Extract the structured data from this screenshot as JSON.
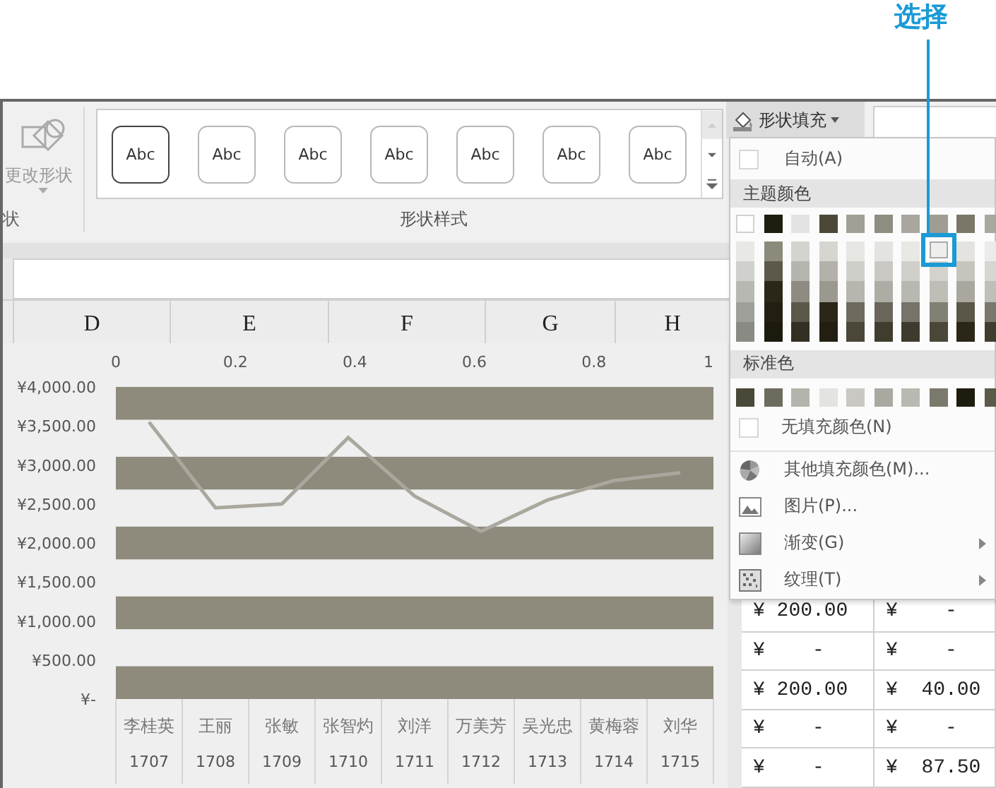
{
  "annotation": {
    "label": "选择"
  },
  "ribbon": {
    "shape_group": {
      "button": "更改形状",
      "caption": "状"
    },
    "shape_styles": {
      "caption": "形状样式",
      "items": [
        {
          "label": "Abc",
          "selected": true
        },
        {
          "label": "Abc",
          "selected": false
        },
        {
          "label": "Abc",
          "selected": false
        },
        {
          "label": "Abc",
          "selected": false
        },
        {
          "label": "Abc",
          "selected": false
        },
        {
          "label": "Abc",
          "selected": false
        },
        {
          "label": "Abc",
          "selected": false
        }
      ]
    },
    "fill_button": {
      "label": "形状填充",
      "expanded": true
    }
  },
  "columns": [
    "D",
    "E",
    "F",
    "G",
    "H"
  ],
  "chart": {
    "chart_data": {
      "type": "line",
      "categories": [
        "李桂英",
        "王丽",
        "张敏",
        "张智灼",
        "刘洋",
        "万美芳",
        "吴光忠",
        "黄梅蓉",
        "刘华"
      ],
      "series": [
        {
          "color": "#aaa89e",
          "values": [
            3550,
            2450,
            2500,
            3350,
            2600,
            2150,
            2550,
            2800,
            2900
          ]
        }
      ],
      "ylim": [
        0,
        4000
      ],
      "yticks": [
        {
          "value": 0,
          "label": "¥-"
        },
        {
          "value": 500,
          "label": "¥500.00"
        },
        {
          "value": 1000,
          "label": "¥1,000.00"
        },
        {
          "value": 1500,
          "label": "¥1,500.00"
        },
        {
          "value": 2000,
          "label": "¥2,000.00"
        },
        {
          "value": 2500,
          "label": "¥2,500.00"
        },
        {
          "value": 3000,
          "label": "¥3,000.00"
        },
        {
          "value": 3500,
          "label": "¥3,500.00"
        },
        {
          "value": 4000,
          "label": "¥4,000.00"
        }
      ]
    },
    "top_axis_labels": [
      "0",
      "0.2",
      "0.4",
      "0.6",
      "0.8",
      "1"
    ],
    "category_codes": [
      "1707",
      "1708",
      "1709",
      "1710",
      "1711",
      "1712",
      "1713",
      "1714",
      "1715"
    ]
  },
  "cells": [
    [
      "¥ 200.00",
      "¥    -"
    ],
    [
      "¥    -",
      "¥    -"
    ],
    [
      "¥ 200.00",
      "¥  40.00"
    ],
    [
      "¥    -",
      "¥    -"
    ],
    [
      "¥    -",
      "¥  87.50"
    ]
  ],
  "fill_menu": {
    "automatic": "自动(A)",
    "theme_header": "主题颜色",
    "theme_top": [
      {
        "color": "#ffffff",
        "selected": false
      },
      {
        "color": "#1f1c10",
        "selected": false
      },
      {
        "color": "#e3e3e1",
        "selected": false
      },
      {
        "color": "#4c4838",
        "selected": false
      },
      {
        "color": "#a19f96",
        "selected": false
      },
      {
        "color": "#8f8c80",
        "selected": false
      },
      {
        "color": "#a8a69e",
        "selected": false
      },
      {
        "color": "#9f9d93",
        "selected": false
      },
      {
        "color": "#7a7768",
        "selected": false
      },
      {
        "color": "#a9a89f",
        "selected": false
      }
    ],
    "theme_shades": [
      [
        {
          "color": "#e8e8e6",
          "selected": false
        },
        {
          "color": "#8c8a7a",
          "selected": false
        },
        {
          "color": "#d3d3cf",
          "selected": false
        },
        {
          "color": "#d6d5d0",
          "selected": false
        },
        {
          "color": "#e6e6e3",
          "selected": false
        },
        {
          "color": "#e3e3e0",
          "selected": false
        },
        {
          "color": "#e8e8e5",
          "selected": false
        },
        {
          "color": "#eeeeec",
          "selected": true
        },
        {
          "color": "#e4e3e0",
          "selected": false
        },
        {
          "color": "#ebebea",
          "selected": false
        }
      ],
      [
        {
          "color": "#d0d0cc",
          "selected": false
        },
        {
          "color": "#5c5948",
          "selected": false
        },
        {
          "color": "#b5b4ad",
          "selected": false
        },
        {
          "color": "#b3b1a9",
          "selected": false
        },
        {
          "color": "#cfcfca",
          "selected": false
        },
        {
          "color": "#c9c8c2",
          "selected": false
        },
        {
          "color": "#d0cfca",
          "selected": false
        },
        {
          "color": "#d3d2cc",
          "selected": false
        },
        {
          "color": "#c5c4bd",
          "selected": false
        },
        {
          "color": "#d5d5d1",
          "selected": false
        }
      ],
      [
        {
          "color": "#b8b8b2",
          "selected": false
        },
        {
          "color": "#2a2718",
          "selected": false
        },
        {
          "color": "#8e8c82",
          "selected": false
        },
        {
          "color": "#9b998f",
          "selected": false
        },
        {
          "color": "#b6b5ae",
          "selected": false
        },
        {
          "color": "#aeada5",
          "selected": false
        },
        {
          "color": "#b8b7b0",
          "selected": false
        },
        {
          "color": "#bebdb6",
          "selected": false
        },
        {
          "color": "#a9a79e",
          "selected": false
        },
        {
          "color": "#bfbeb8",
          "selected": false
        }
      ],
      [
        {
          "color": "#a0a09a",
          "selected": false
        },
        {
          "color": "#221f12",
          "selected": false
        },
        {
          "color": "#5a5849",
          "selected": false
        },
        {
          "color": "#2a2718",
          "selected": false
        },
        {
          "color": "#6e6b5e",
          "selected": false
        },
        {
          "color": "#6a675a",
          "selected": false
        },
        {
          "color": "#75736a",
          "selected": false
        },
        {
          "color": "#808073",
          "selected": false
        },
        {
          "color": "#5a5748",
          "selected": false
        },
        {
          "color": "#7a786d",
          "selected": false
        }
      ],
      [
        {
          "color": "#8a8a84",
          "selected": false
        },
        {
          "color": "#1c190d",
          "selected": false
        },
        {
          "color": "#333023",
          "selected": false
        },
        {
          "color": "#221f12",
          "selected": false
        },
        {
          "color": "#4a4738",
          "selected": false
        },
        {
          "color": "#403d2f",
          "selected": false
        },
        {
          "color": "#3e3b2e",
          "selected": false
        },
        {
          "color": "#4a4738",
          "selected": false
        },
        {
          "color": "#2a2718",
          "selected": false
        },
        {
          "color": "#403d2f",
          "selected": false
        }
      ]
    ],
    "standard_header": "标准色",
    "standard_colors": [
      {
        "color": "#4a4838",
        "selected": false
      },
      {
        "color": "#6d6b5e",
        "selected": false
      },
      {
        "color": "#b4b3ac",
        "selected": false
      },
      {
        "color": "#e3e3e0",
        "selected": false
      },
      {
        "color": "#c9c8c2",
        "selected": false
      },
      {
        "color": "#aaa9a1",
        "selected": false
      },
      {
        "color": "#b9b8b1",
        "selected": false
      },
      {
        "color": "#7b796c",
        "selected": false
      },
      {
        "color": "#1e1b0f",
        "selected": false
      },
      {
        "color": "#5c5a48",
        "selected": false
      }
    ],
    "items": [
      {
        "kind": "no_fill",
        "label": "无填充颜色(N)",
        "submenu": false
      },
      {
        "kind": "more_colors",
        "label": "其他填充颜色(M)...",
        "submenu": false
      },
      {
        "kind": "picture",
        "label": "图片(P)...",
        "submenu": false
      },
      {
        "kind": "gradient",
        "label": "渐变(G)",
        "submenu": true
      },
      {
        "kind": "texture",
        "label": "纹理(T)",
        "submenu": true
      }
    ]
  }
}
